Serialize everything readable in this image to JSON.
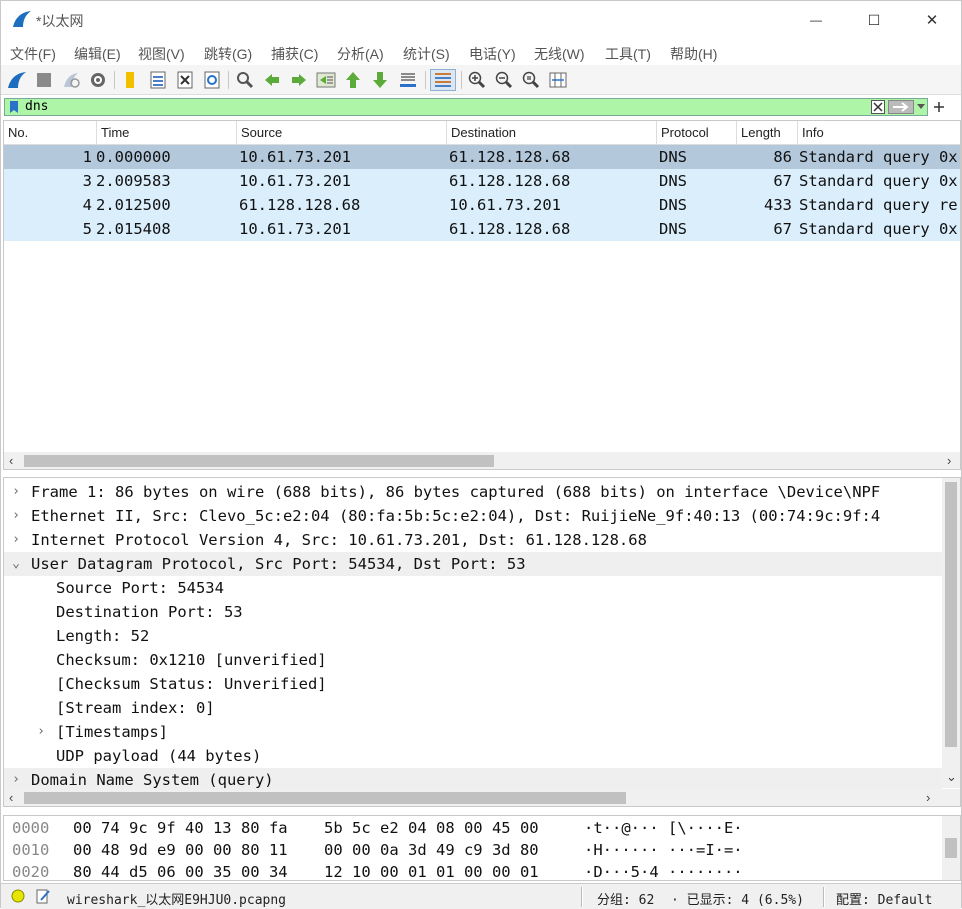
{
  "window": {
    "title": "*以太网",
    "minimize_glyph": "—",
    "maximize_glyph": "☐",
    "close_glyph": "✕"
  },
  "menu": [
    "文件(F)",
    "编辑(E)",
    "视图(V)",
    "跳转(G)",
    "捕获(C)",
    "分析(A)",
    "统计(S)",
    "电话(Y)",
    "无线(W)",
    "工具(T)",
    "帮助(H)"
  ],
  "filter": {
    "value": "dns"
  },
  "packet_list": {
    "columns": [
      "No.",
      "Time",
      "Source",
      "Destination",
      "Protocol",
      "Length",
      "Info"
    ],
    "rows": [
      {
        "no": "1",
        "time": "0.000000",
        "source": "10.61.73.201",
        "destination": "61.128.128.68",
        "protocol": "DNS",
        "length": "86",
        "info": "Standard query 0x"
      },
      {
        "no": "3",
        "time": "2.009583",
        "source": "10.61.73.201",
        "destination": "61.128.128.68",
        "protocol": "DNS",
        "length": "67",
        "info": "Standard query 0x"
      },
      {
        "no": "4",
        "time": "2.012500",
        "source": "61.128.128.68",
        "destination": "10.61.73.201",
        "protocol": "DNS",
        "length": "433",
        "info": "Standard query re"
      },
      {
        "no": "5",
        "time": "2.015408",
        "source": "10.61.73.201",
        "destination": "61.128.128.68",
        "protocol": "DNS",
        "length": "67",
        "info": "Standard query 0x"
      }
    ],
    "selected_index": 0
  },
  "details": [
    {
      "text": "Frame 1: 86 bytes on wire (688 bits), 86 bytes captured (688 bits) on interface \\Device\\NPF",
      "exp": "›",
      "indent": 0
    },
    {
      "text": "Ethernet II, Src: Clevo_5c:e2:04 (80:fa:5b:5c:e2:04), Dst: RuijieNe_9f:40:13 (00:74:9c:9f:4",
      "exp": "›",
      "indent": 0
    },
    {
      "text": "Internet Protocol Version 4, Src: 10.61.73.201, Dst: 61.128.128.68",
      "exp": "›",
      "indent": 0
    },
    {
      "text": "User Datagram Protocol, Src Port: 54534, Dst Port: 53",
      "exp": "⌄",
      "indent": 0,
      "highlight": true
    },
    {
      "text": "Source Port: 54534",
      "exp": "",
      "indent": 1
    },
    {
      "text": "Destination Port: 53",
      "exp": "",
      "indent": 1
    },
    {
      "text": "Length: 52",
      "exp": "",
      "indent": 1
    },
    {
      "text": "Checksum: 0x1210 [unverified]",
      "exp": "",
      "indent": 1
    },
    {
      "text": "[Checksum Status: Unverified]",
      "exp": "",
      "indent": 1
    },
    {
      "text": "[Stream index: 0]",
      "exp": "",
      "indent": 1
    },
    {
      "text": "[Timestamps]",
      "exp": "›",
      "indent": 1
    },
    {
      "text": "UDP payload (44 bytes)",
      "exp": "",
      "indent": 1
    },
    {
      "text": "Domain Name System (query)",
      "exp": "›",
      "indent": 0,
      "highlight": true
    }
  ],
  "hex": [
    {
      "offset": "0000",
      "bytes1": "00 74 9c 9f 40 13 80 fa",
      "bytes2": "5b 5c e2 04 08 00 45 00",
      "ascii": "·t··@···  [\\····E·"
    },
    {
      "offset": "0010",
      "bytes1": "00 48 9d e9 00 00 80 11",
      "bytes2": "00 00 0a 3d 49 c9 3d 80",
      "ascii": "·H······  ···=I·=·"
    },
    {
      "offset": "0020",
      "bytes1": "80 44 d5 06 00 35 00 34",
      "bytes2": "12 10 00 01 01 00 00 01",
      "ascii": "·D···5·4  ········"
    }
  ],
  "status": {
    "file": "wireshark_以太网E9HJU0.pcapng",
    "packets": "分组: 62",
    "displayed": "· 已显示: 4 (6.5%)",
    "profile": "配置: Default"
  },
  "colors": {
    "row_selected": "#b4c8dc",
    "row_dns": "#daeefc",
    "filter_valid": "#aff5a8",
    "detail_highlight": "#efefef",
    "status_ok": "#e6e600"
  },
  "toolbar_icons": [
    "shark-fin-start-icon",
    "stop-icon",
    "restart-icon",
    "options-gear-icon",
    "open-folder-icon",
    "save-file-icon",
    "close-file-icon",
    "reload-icon",
    "find-icon",
    "go-back-icon",
    "go-forward-icon",
    "go-to-packet-icon",
    "first-packet-icon",
    "last-packet-icon",
    "auto-scroll-icon",
    "colorize-icon",
    "zoom-in-icon",
    "zoom-out-icon",
    "normal-size-icon",
    "resize-columns-icon"
  ]
}
